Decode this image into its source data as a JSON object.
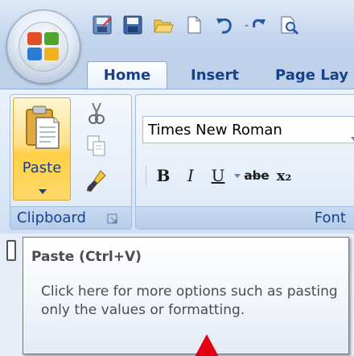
{
  "tabs": [
    {
      "label": "Home",
      "selected": true
    },
    {
      "label": "Insert",
      "selected": false
    },
    {
      "label": "Page Lay",
      "selected": false
    }
  ],
  "clipboard": {
    "paste_label": "Paste",
    "group_label": "Clipboard"
  },
  "font": {
    "font_name": "Times New Roman",
    "group_label": "Font",
    "bold_label": "B",
    "italic_label": "I",
    "underline_label": "U",
    "strike_label": "abe",
    "subscript_label": "x₂"
  },
  "tooltip": {
    "title": "Paste (Ctrl+V)",
    "body": "Click here for more options such as pasting only the values or formatting."
  },
  "colors": {
    "accent_text": "#15428b",
    "paste_highlight": "#ffcf45",
    "annotation_arrow": "#e0000f"
  },
  "icons": [
    "office-button-icon",
    "save-icon",
    "save-as-icon",
    "open-folder-icon",
    "new-document-icon",
    "undo-icon",
    "redo-icon",
    "print-preview-icon",
    "paste-icon",
    "cut-icon",
    "copy-icon",
    "format-painter-icon",
    "dialog-launcher-icon",
    "annotation-arrow-icon"
  ]
}
